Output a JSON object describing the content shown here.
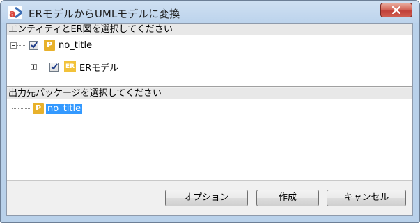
{
  "window": {
    "title": "ERモデルからUMLモデルに変換",
    "close_label": "x"
  },
  "section1": {
    "header": "エンティティとER図を選択してください",
    "root_item": {
      "label": "no_title",
      "icon_letter": "P",
      "checked": true,
      "expanded": true
    },
    "child_item": {
      "label": "ERモデル",
      "icon_letter": "ER",
      "checked": true,
      "expanded": false
    }
  },
  "section2": {
    "header": "出力先パッケージを選択してください",
    "item": {
      "label": "no_title",
      "icon_letter": "P",
      "selected": true
    }
  },
  "buttons": {
    "options": "オプション",
    "create": "作成",
    "cancel": "キャンセル"
  },
  "colors": {
    "selection": "#3399ff",
    "package_icon": "#e8b12b",
    "er_icon": "#f2c23a",
    "close_button": "#c1403a"
  }
}
